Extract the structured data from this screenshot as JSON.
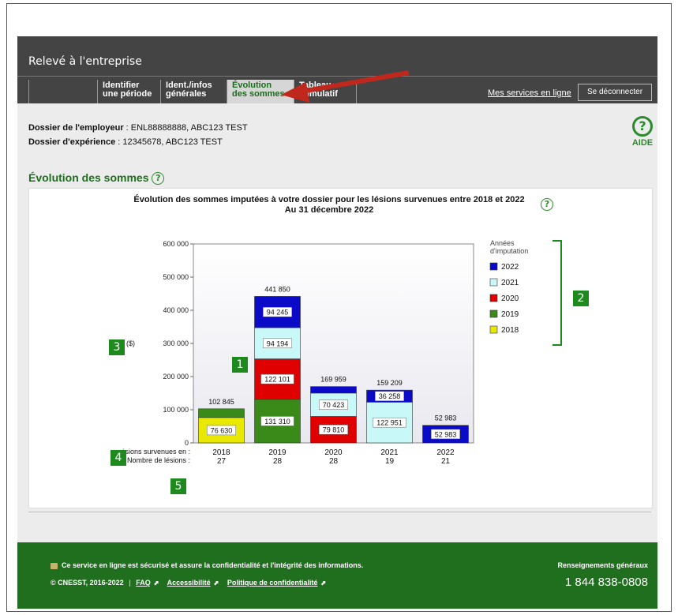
{
  "app": {
    "title": "Relevé à l'entreprise"
  },
  "tabs": [
    {
      "l1": "",
      "l2": ""
    },
    {
      "l1": "Identifier",
      "l2": "une période"
    },
    {
      "l1": "Ident./infos",
      "l2": "générales"
    },
    {
      "l1": "Évolution",
      "l2": "des sommes"
    },
    {
      "l1": "Tableau",
      "l2": "cumulatif"
    }
  ],
  "header_links": {
    "services": "Mes services en ligne",
    "logout": "Se déconnecter"
  },
  "dossier": {
    "employer_label": "Dossier de l'employeur",
    "employer_value": " : ENL88888888, ABC123 TEST",
    "experience_label": "Dossier d'expérience",
    "experience_value": " : 12345678, ABC123 TEST"
  },
  "help": {
    "symbol": "?",
    "label": "AIDE"
  },
  "section": {
    "title": "Évolution des sommes"
  },
  "chart_data": {
    "type": "bar",
    "stacked": true,
    "title": "Évolution des sommes imputées à votre dossier pour les lésions survenues entre 2018 et 2022",
    "subtitle": "Au 31 décembre 2022",
    "ylabel": "($)",
    "ylim": [
      0,
      600000
    ],
    "yticks": [
      "0",
      "100 000",
      "200 000",
      "300 000",
      "400 000",
      "500 000",
      "600 000"
    ],
    "categories": [
      "2018",
      "2019",
      "2020",
      "2021",
      "2022"
    ],
    "row1_label": "Lésions survenues en :",
    "row2_label": "Nombre de lésions :",
    "lesions": [
      "27",
      "28",
      "28",
      "19",
      "21"
    ],
    "totals": [
      "102 845",
      "441 850",
      "169 959",
      "159 209",
      "52 983"
    ],
    "legend_title": [
      "Années",
      "d'imputation"
    ],
    "legend_position": "right",
    "series": [
      {
        "name": "2018",
        "color": "#e8e800",
        "values": [
          76630,
          0,
          0,
          0,
          0
        ],
        "labels": [
          "76 630",
          "",
          "",
          "",
          ""
        ]
      },
      {
        "name": "2019",
        "color": "#3a8a1a",
        "values": [
          26215,
          131310,
          0,
          0,
          0
        ],
        "labels": [
          "",
          "131 310",
          "",
          "",
          ""
        ]
      },
      {
        "name": "2020",
        "color": "#e00000",
        "values": [
          0,
          122101,
          79810,
          0,
          0
        ],
        "labels": [
          "",
          "122 101",
          "79 810",
          "",
          ""
        ]
      },
      {
        "name": "2021",
        "color": "#c8f8f8",
        "values": [
          0,
          94194,
          70423,
          122951,
          0
        ],
        "labels": [
          "",
          "94 194",
          "70 423",
          "122 951",
          ""
        ]
      },
      {
        "name": "2022",
        "color": "#0a0ac8",
        "values": [
          0,
          94245,
          19726,
          36258,
          52983
        ],
        "labels": [
          "",
          "94 245",
          "",
          "36 258",
          "52 983"
        ]
      }
    ]
  },
  "annotations": [
    "1",
    "2",
    "3",
    "4",
    "5"
  ],
  "footer": {
    "security": "Ce service en ligne est sécurisé et assure la confidentialité et l'intégrité des informations.",
    "copyright": "© CNESST, 2016-2022",
    "faq": "FAQ",
    "accessibility": "Accessibilité",
    "privacy": "Politique de confidentialité",
    "info_label": "Renseignements généraux",
    "phone": "1 844 838-0808"
  }
}
